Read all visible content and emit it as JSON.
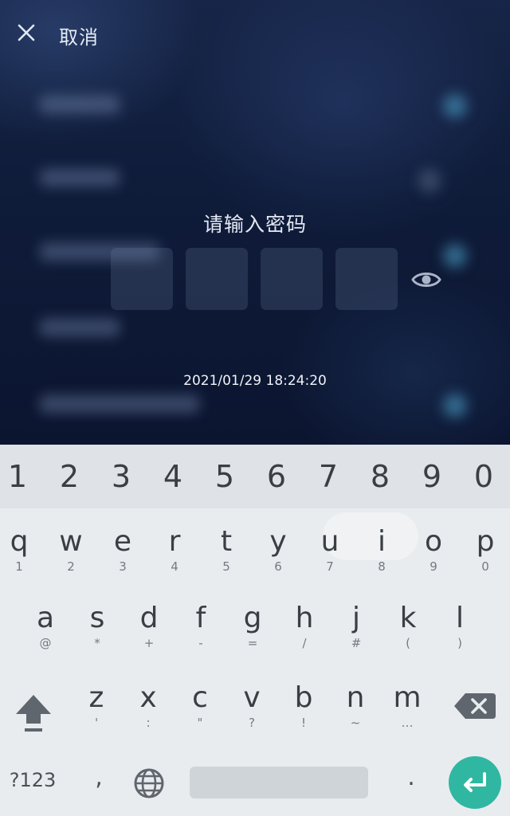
{
  "header": {
    "close_icon": "close-icon",
    "cancel_label": "取消"
  },
  "password_prompt": {
    "title": "请输入密码",
    "pin_length": 4,
    "visibility_icon": "eye-icon",
    "timestamp": "2021/01/29 18:24:20"
  },
  "keyboard": {
    "numbers": [
      "1",
      "2",
      "3",
      "4",
      "5",
      "6",
      "7",
      "8",
      "9",
      "0"
    ],
    "row1": [
      {
        "key": "q",
        "hint": "1"
      },
      {
        "key": "w",
        "hint": "2"
      },
      {
        "key": "e",
        "hint": "3"
      },
      {
        "key": "r",
        "hint": "4"
      },
      {
        "key": "t",
        "hint": "5"
      },
      {
        "key": "y",
        "hint": "6"
      },
      {
        "key": "u",
        "hint": "7"
      },
      {
        "key": "i",
        "hint": "8"
      },
      {
        "key": "o",
        "hint": "9"
      },
      {
        "key": "p",
        "hint": "0"
      }
    ],
    "row2": [
      {
        "key": "a",
        "hint": "@"
      },
      {
        "key": "s",
        "hint": "*"
      },
      {
        "key": "d",
        "hint": "+"
      },
      {
        "key": "f",
        "hint": "-"
      },
      {
        "key": "g",
        "hint": "="
      },
      {
        "key": "h",
        "hint": "/"
      },
      {
        "key": "j",
        "hint": "#"
      },
      {
        "key": "k",
        "hint": "("
      },
      {
        "key": "l",
        "hint": ")"
      }
    ],
    "row3": [
      {
        "key": "z",
        "hint": "'"
      },
      {
        "key": "x",
        "hint": ":"
      },
      {
        "key": "c",
        "hint": "\""
      },
      {
        "key": "v",
        "hint": "?"
      },
      {
        "key": "b",
        "hint": "!"
      },
      {
        "key": "n",
        "hint": "~"
      },
      {
        "key": "m",
        "hint": "…"
      }
    ],
    "symbols_label": "?123",
    "comma_label": ",",
    "period_label": ".",
    "shift_icon": "shift-icon",
    "backspace_icon": "backspace-icon",
    "globe_icon": "globe-icon",
    "enter_icon": "enter-icon",
    "accent_color": "#2fb7a2"
  }
}
